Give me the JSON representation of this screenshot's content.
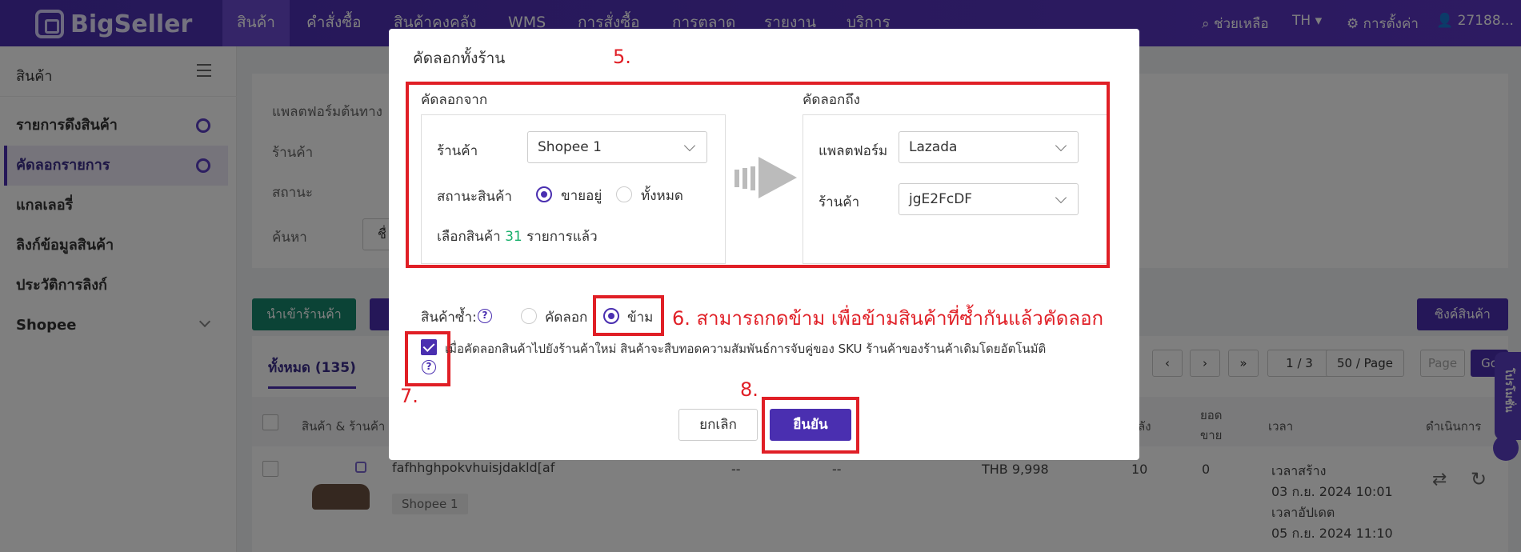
{
  "topbar": {
    "brand": "BigSeller",
    "nav": [
      "สินค้า",
      "คำสั่งซื้อ",
      "สินค้าคงคลัง",
      "WMS",
      "การสั่งซื้อ",
      "การตลาด",
      "รายงาน",
      "บริการ"
    ],
    "help": "ช่วยเหลือ",
    "lang": "TH",
    "settings": "การตั้งค่า",
    "account": "27188..."
  },
  "sidebar": {
    "title": "สินค้า",
    "items": [
      {
        "label": "รายการดึงสินค้า"
      },
      {
        "label": "คัดลอกรายการ"
      },
      {
        "label": "แกลเลอรี่"
      },
      {
        "label": "ลิงก์ข้อมูลสินค้า"
      },
      {
        "label": "ประวัติการลิงก์"
      },
      {
        "label": "Shopee"
      }
    ]
  },
  "background": {
    "filters": [
      "แพลตฟอร์มต้นทาง",
      "ร้านค้า",
      "สถานะ",
      "ค้นหา"
    ],
    "search_prefix": "ชื่",
    "import_button": "นำเข้าร้านค้า",
    "sync_button": "ซิงค์สินค้า",
    "tab_all": "ทั้งหมด (135)",
    "pager": {
      "page": "1 / 3",
      "per_page": "50 / Page",
      "page_placeholder": "Page",
      "go": "Go"
    },
    "columns": {
      "product": "สินค้า & ร้านค้า",
      "stock": "ลัง",
      "sold_1": "ยอด",
      "sold_2": "ขาย",
      "time": "เวลา",
      "actions": "ดำเนินการ"
    },
    "row": {
      "name": "fafhhghpokvhuisjdakld[af",
      "store_tag": "Shopee 1",
      "c1": "--",
      "c2": "--",
      "price": "THB 9,998",
      "stock": "10",
      "sold": "0",
      "created_label": "เวลาสร้าง",
      "created": "03 ก.ย. 2024 10:01",
      "updated_label": "เวลาอัปเดต",
      "updated": "05 ก.ย. 2024 11:10"
    },
    "float_tab": "โปรโมชั่น"
  },
  "modal": {
    "title": "คัดลอกทั้งร้าน",
    "from": {
      "heading": "คัดลอกจาก",
      "store_label": "ร้านค้า",
      "store_value": "Shopee 1",
      "status_label": "สถานะสินค้า",
      "status_options": [
        "ขายอยู่",
        "ทั้งหมด"
      ],
      "selected_prefix": "เลือกสินค้า",
      "selected_count": "31",
      "selected_suffix": "รายการแล้ว"
    },
    "to": {
      "heading": "คัดลอกถึง",
      "platform_label": "แพลตฟอร์ม",
      "platform_value": "Lazada",
      "store_label": "ร้านค้า",
      "store_value": "jgE2FcDF"
    },
    "duplicate": {
      "label": "สินค้าซ้ำ:",
      "options": [
        "คัดลอก",
        "ข้าม"
      ]
    },
    "sku_note": "เมื่อคัดลอกสินค้าไปยังร้านค้าใหม่ สินค้าจะสืบทอดความสัมพันธ์การจับคู่ของ SKU ร้านค้าของร้านค้าเดิมโดยอัตโนมัติ",
    "cancel": "ยกเลิก",
    "confirm": "ยืนยัน"
  },
  "annotations": {
    "a5": "5.",
    "a6": "6. สามารถกดข้าม เพื่อข้ามสินค้าที่ซ้ำกันแล้วคัดลอก",
    "a7": "7.",
    "a8": "8."
  },
  "colors": {
    "brand": "#4a2fb0",
    "annotation": "#e01f26",
    "count_green": "#19b06c",
    "import_green": "#17866c"
  }
}
